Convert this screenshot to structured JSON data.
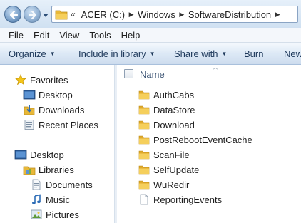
{
  "address": {
    "overflow": "«",
    "crumbs": [
      "ACER (C:)",
      "Windows",
      "SoftwareDistribution"
    ]
  },
  "menu": [
    "File",
    "Edit",
    "View",
    "Tools",
    "Help"
  ],
  "commands": {
    "organize": "Organize",
    "include": "Include in library",
    "share": "Share with",
    "burn": "Burn",
    "new_folder": "New folder"
  },
  "navigation": {
    "favorites": {
      "label": "Favorites",
      "items": [
        "Desktop",
        "Downloads",
        "Recent Places"
      ]
    },
    "desktop": "Desktop",
    "libraries": {
      "label": "Libraries",
      "items": [
        "Documents",
        "Music",
        "Pictures"
      ]
    }
  },
  "content": {
    "column_name": "Name",
    "items": [
      {
        "name": "AuthCabs",
        "type": "folder"
      },
      {
        "name": "DataStore",
        "type": "folder"
      },
      {
        "name": "Download",
        "type": "folder"
      },
      {
        "name": "PostRebootEventCache",
        "type": "folder"
      },
      {
        "name": "ScanFile",
        "type": "folder"
      },
      {
        "name": "SelfUpdate",
        "type": "folder"
      },
      {
        "name": "WuRedir",
        "type": "folder"
      },
      {
        "name": "ReportingEvents",
        "type": "file"
      }
    ]
  },
  "icons": {
    "back": "back-arrow-icon",
    "forward": "forward-arrow-icon",
    "folder": "folder-icon",
    "file": "document-icon",
    "favorites": "star-icon",
    "libraries": "libraries-icon"
  },
  "colors": {
    "folder": "#e8b838",
    "nav_button": "#4f7fb3",
    "command_text": "#1e395b"
  }
}
